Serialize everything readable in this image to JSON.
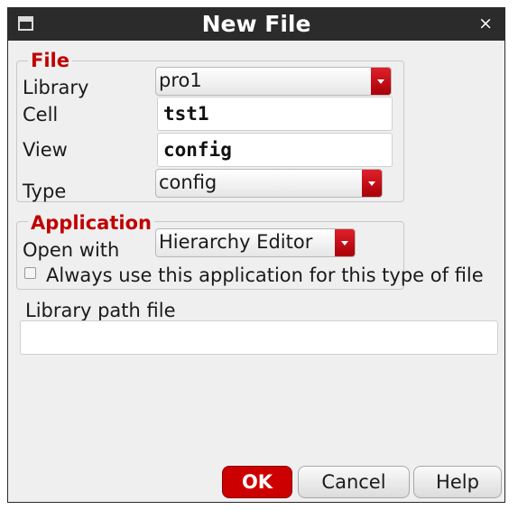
{
  "window": {
    "title": "New File",
    "close_glyph": "×",
    "icon": "window-icon"
  },
  "file_group": {
    "legend": "File",
    "library_label": "Library",
    "library_value": "pro1",
    "cell_label": "Cell",
    "cell_value": "tst1",
    "view_label": "View",
    "view_value": "config",
    "type_label": "Type",
    "type_value": "config"
  },
  "application_group": {
    "legend": "Application",
    "open_with_label": "Open with",
    "open_with_value": "Hierarchy Editor",
    "always_use_label": "Always use this application for this type of file",
    "always_use_checked": false
  },
  "library_path": {
    "label": "Library path file",
    "value": ""
  },
  "buttons": {
    "ok": "OK",
    "cancel": "Cancel",
    "help": "Help"
  },
  "colors": {
    "accent": "#cc0000",
    "titlebar": "#2b2b2b",
    "dialog_bg": "#efefef"
  }
}
